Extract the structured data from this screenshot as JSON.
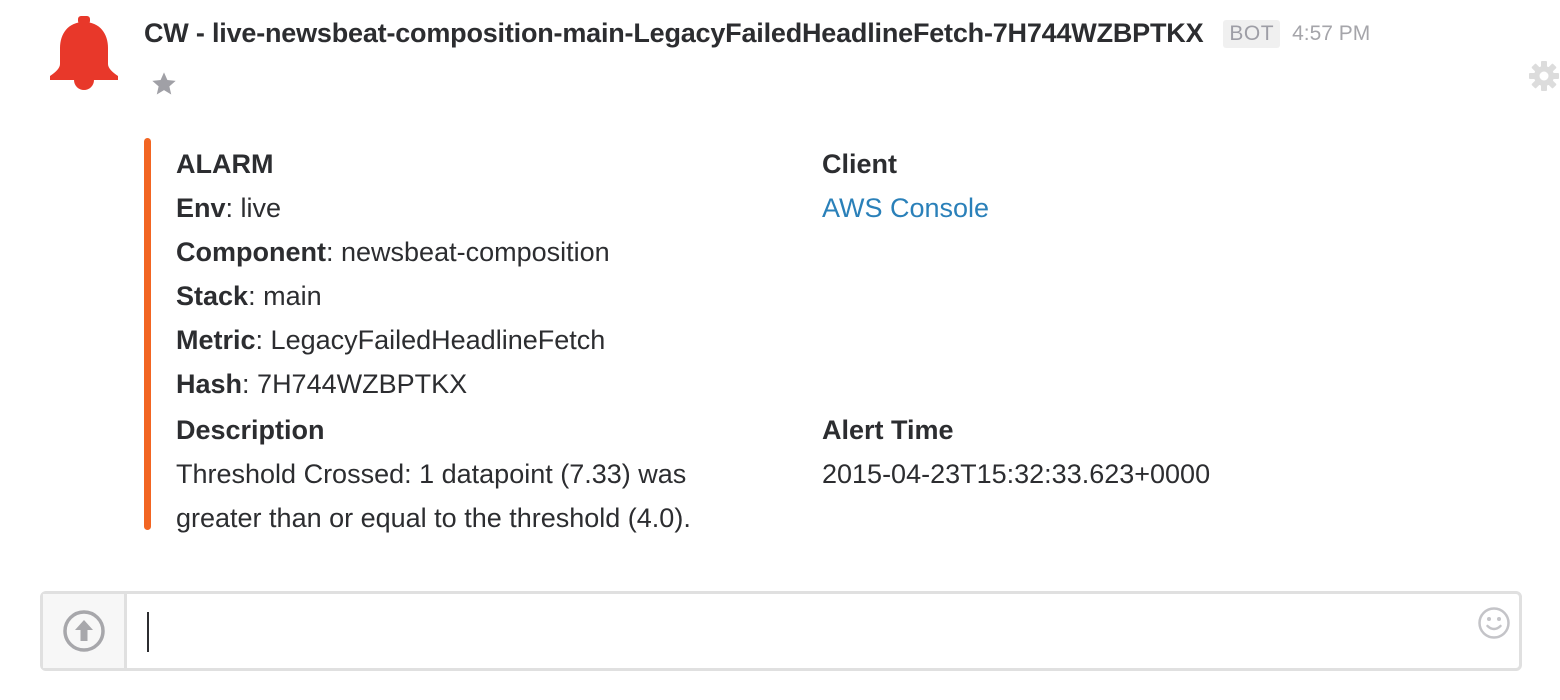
{
  "message": {
    "sender": "CW - live-newsbeat-composition-main-LegacyFailedHeadlineFetch-7H744WZBPTKX",
    "badge": "BOT",
    "timestamp": "4:57 PM",
    "avatar_icon": "bell-icon",
    "avatar_color": "#e8382a"
  },
  "attachment": {
    "accent_color": "#f26522",
    "alarm_title": "ALARM",
    "fields": [
      {
        "key": "Env",
        "sep": ": ",
        "value": "live"
      },
      {
        "key": "Component",
        "sep": ": ",
        "value": "newsbeat-composition"
      },
      {
        "key": "Stack",
        "sep": ": ",
        "value": "main"
      },
      {
        "key": "Metric",
        "sep": ": ",
        "value": "LegacyFailedHeadlineFetch"
      },
      {
        "key": "Hash",
        "sep": ": ",
        "value": "7H744WZBPTKX"
      }
    ],
    "client_title": "Client",
    "client_link": "AWS Console",
    "description_title": "Description",
    "description_line1": "Threshold Crossed: 1 datapoint (7.33) was",
    "description_line2": "greater than or equal to the threshold (4.0).",
    "alert_time_title": "Alert Time",
    "alert_time_value": "2015-04-23T15:32:33.623+0000"
  },
  "composer": {
    "input_value": "",
    "upload_icon": "upload-arrow-icon",
    "emoji_icon": "smiley-icon"
  },
  "icons": {
    "star": "star-icon",
    "settings": "gear-icon"
  }
}
